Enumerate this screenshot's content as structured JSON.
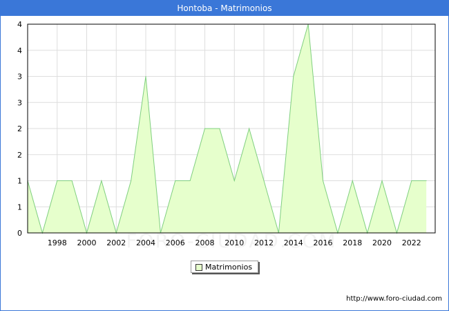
{
  "window": {
    "title": "Hontoba - Matrimonios"
  },
  "watermark": "FORO-CIUDAD.COM",
  "source_url": "http://www.foro-ciudad.com",
  "colors": {
    "titlebar": "#3a77d8",
    "series_fill": "#e6ffcc",
    "series_line": "#7fcf7f",
    "grid": "#dddddd",
    "axis": "#000000"
  },
  "chart_data": {
    "type": "area",
    "title": "Hontoba - Matrimonios",
    "xlabel": "",
    "ylabel": "",
    "x": [
      1996,
      1997,
      1998,
      1999,
      2000,
      2001,
      2002,
      2003,
      2004,
      2005,
      2006,
      2007,
      2008,
      2009,
      2010,
      2011,
      2012,
      2013,
      2014,
      2015,
      2016,
      2017,
      2018,
      2019,
      2020,
      2021,
      2022,
      2023
    ],
    "series": [
      {
        "name": "Matrimonios",
        "values": [
          1,
          0,
          1,
          1,
          0,
          1,
          0,
          1,
          3,
          0,
          1,
          1,
          2,
          2,
          1,
          2,
          1,
          0,
          3,
          4,
          1,
          0,
          1,
          0,
          1,
          0,
          1,
          1
        ]
      }
    ],
    "xlim": [
      1996,
      2023.6
    ],
    "ylim": [
      0,
      4
    ],
    "x_ticks": [
      1998,
      2000,
      2002,
      2004,
      2006,
      2008,
      2010,
      2012,
      2014,
      2016,
      2018,
      2020,
      2022
    ],
    "y_tick_labels": [
      "0",
      "1",
      "1",
      "2",
      "2",
      "3",
      "3",
      "4",
      "4"
    ],
    "grid": true,
    "legend": {
      "position": "bottom-center",
      "entries": [
        "Matrimonios"
      ]
    }
  }
}
